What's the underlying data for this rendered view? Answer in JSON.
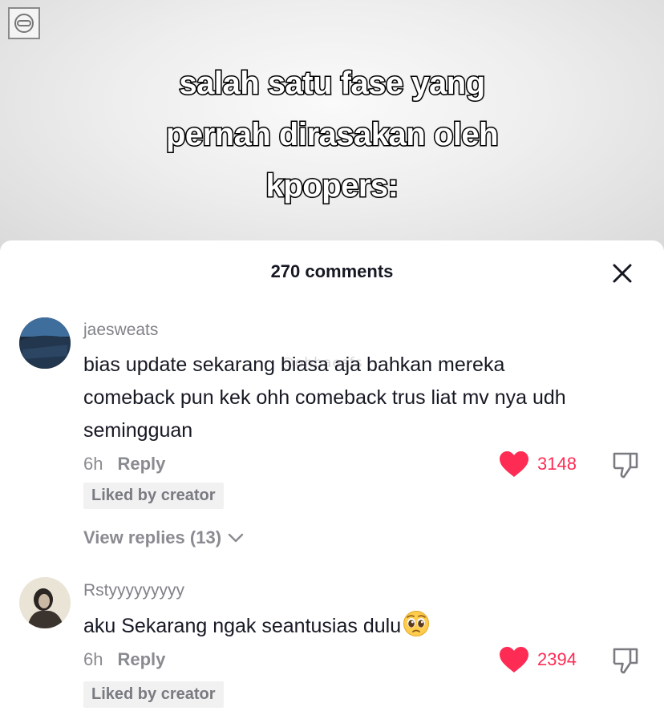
{
  "video": {
    "caption_lines": [
      "salah satu fase yang",
      "pernah dirasakan oleh",
      "kpopers:"
    ]
  },
  "comments_panel": {
    "title": "270 comments",
    "close_icon": "close-icon",
    "watermark": "@ohbaesfs"
  },
  "comments": [
    {
      "username": "jaesweats",
      "text": "bias update sekarang biasa aja bahkan mereka comeback pun kek ohh comeback trus liat mv nya udh semingguan",
      "time": "6h",
      "reply_label": "Reply",
      "likes": "3148",
      "liked_badge": "Liked by creator",
      "view_replies": "View replies (13)"
    },
    {
      "username": "Rstyyyyyyyyy",
      "text": "aku Sekarang ngak seantusias dulu",
      "emoji": "pleading-face-emoji",
      "time": "6h",
      "reply_label": "Reply",
      "likes": "2394",
      "liked_badge": "Liked by creator"
    }
  ],
  "colors": {
    "heart": "#fe2c55",
    "text_primary": "#161823",
    "text_secondary": "#8a8b91"
  }
}
